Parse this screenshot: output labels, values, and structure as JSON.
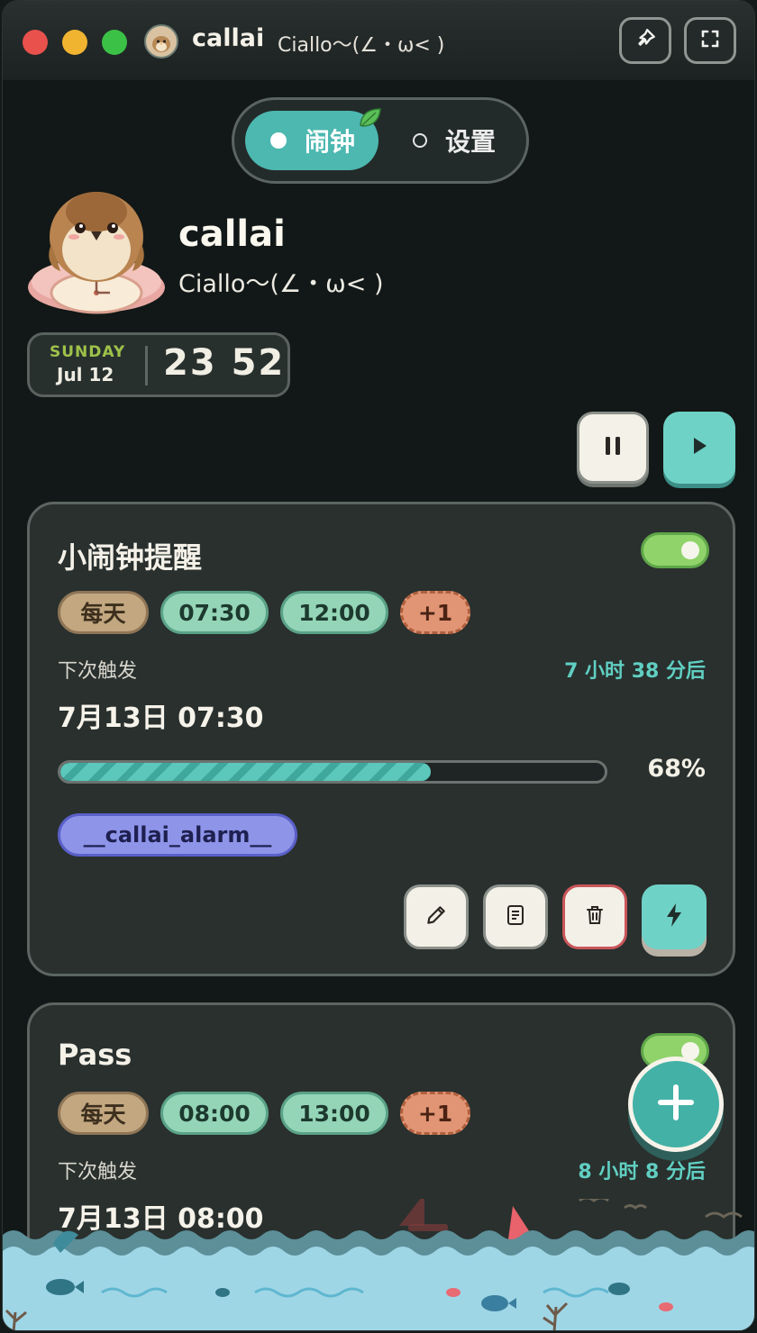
{
  "window": {
    "app_name": "callai",
    "subtitle": "Ciallo～(∠・ω< )"
  },
  "tabs": [
    {
      "label": "闹钟",
      "active": true
    },
    {
      "label": "设置",
      "active": false
    }
  ],
  "profile": {
    "name": "callai",
    "motto": "Ciallo～(∠・ω< )"
  },
  "clock": {
    "weekday": "SUNDAY",
    "date": "Jul 12",
    "time": "23 52"
  },
  "alarms": [
    {
      "title": "小闹钟提醒",
      "enabled": true,
      "repeat": "每天",
      "times": [
        "07:30",
        "12:00"
      ],
      "more": "+1",
      "next_label": "下次触发",
      "remaining": "7 小时 38 分后",
      "next_time": "7月13日 07:30",
      "progress": 0.68,
      "progress_label": "68%",
      "tag": "__callai_alarm__"
    },
    {
      "title": "Pass",
      "enabled": true,
      "repeat": "每天",
      "times": [
        "08:00",
        "13:00"
      ],
      "more": "+1",
      "next_label": "下次触发",
      "remaining": "8 小时 8 分后",
      "next_time": "7月13日 08:00"
    }
  ],
  "colors": {
    "accent": "#4cb8b0",
    "background": "#121817",
    "card": "#29302e",
    "toggle_on": "#8fd36a",
    "tag": "#8e94e8"
  }
}
